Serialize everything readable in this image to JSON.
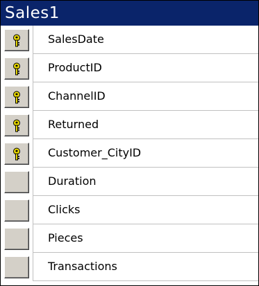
{
  "table": {
    "title": "Sales1",
    "fields": [
      {
        "name": "SalesDate",
        "primary_key": true,
        "icon": "key-icon"
      },
      {
        "name": "ProductID",
        "primary_key": true,
        "icon": "key-icon"
      },
      {
        "name": "ChannelID",
        "primary_key": true,
        "icon": "key-icon"
      },
      {
        "name": "Returned",
        "primary_key": true,
        "icon": "key-icon"
      },
      {
        "name": "Customer_CityID",
        "primary_key": true,
        "icon": "key-icon"
      },
      {
        "name": "Duration",
        "primary_key": false
      },
      {
        "name": "Clicks",
        "primary_key": false
      },
      {
        "name": "Pieces",
        "primary_key": false
      },
      {
        "name": "Transactions",
        "primary_key": false
      }
    ]
  },
  "colors": {
    "title_bar": "#0a246a",
    "title_text": "#ffffff",
    "key_icon": "#e8d800"
  }
}
